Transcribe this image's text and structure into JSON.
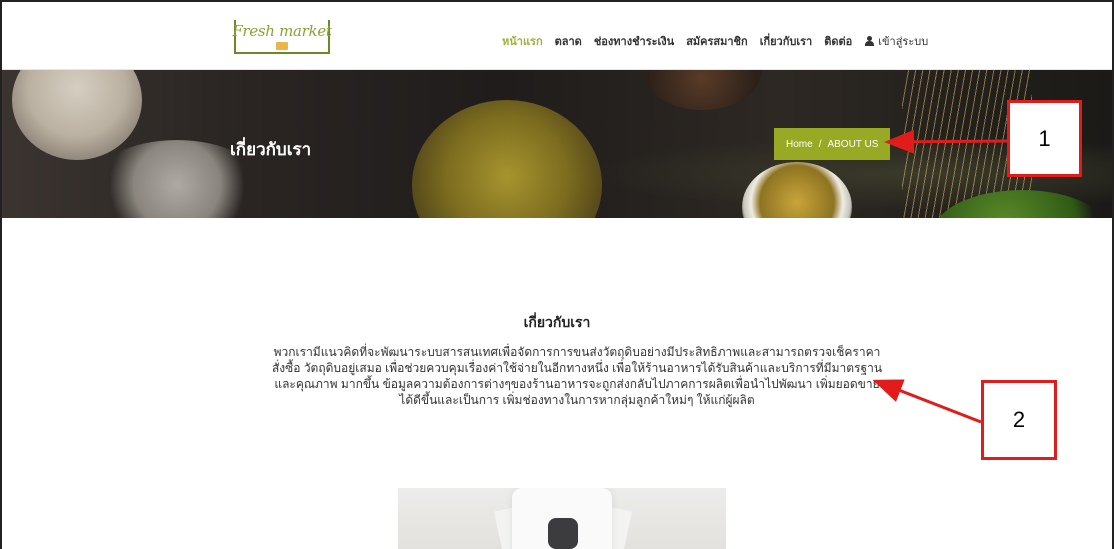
{
  "header": {
    "logo_text": "Fresh market",
    "nav": [
      {
        "label": "หน้าแรก",
        "active": true
      },
      {
        "label": "ตลาด",
        "active": false
      },
      {
        "label": "ช่องทางชำระเงิน",
        "active": false
      },
      {
        "label": "สมัครสมาชิก",
        "active": false
      },
      {
        "label": "เกี่ยวกับเรา",
        "active": false
      },
      {
        "label": "ติดต่อ",
        "active": false
      }
    ],
    "login_label": "เข้าสู่ระบบ",
    "login_icon": "user-icon",
    "accent_color": "#9fb43a"
  },
  "banner": {
    "title": "เกี่ยวกับเรา",
    "breadcrumb": {
      "home": "Home",
      "separator": "/",
      "current": "ABOUT US"
    },
    "breadcrumb_color": "#98aa24"
  },
  "annotations": {
    "one": "1",
    "two": "2",
    "color": "#e21b1b"
  },
  "content": {
    "heading": "เกี่ยวกับเรา",
    "paragraph": "พวกเรามีแนวคิดที่จะพัฒนาระบบสารสนเทศเพื่อจัดการการขนส่งวัตถุดิบอย่างมีประสิทธิภาพและสามารถตรวจเช็คราคาสั่งซื้อ วัตถุดิบอยู่เสมอ เพื่อช่วยควบคุมเรื่องค่าใช้จ่ายในอีกทางหนึ่ง เพื่อให้ร้านอาหารได้รับสินค้าและบริการที่มีมาตรฐานและคุณภาพ มากขึ้น ข้อมูลความต้องการต่างๆของร้านอาหารจะถูกส่งกลับไปภาคการผลิตเพื่อนำไปพัฒนา เพิ่มยอดขายได้ดีขึ้นและเป็นการ เพิ่มช่องทางในการหากลุ่มลูกค้าใหม่ๆ ให้แก่ผู้ผลิต"
  }
}
